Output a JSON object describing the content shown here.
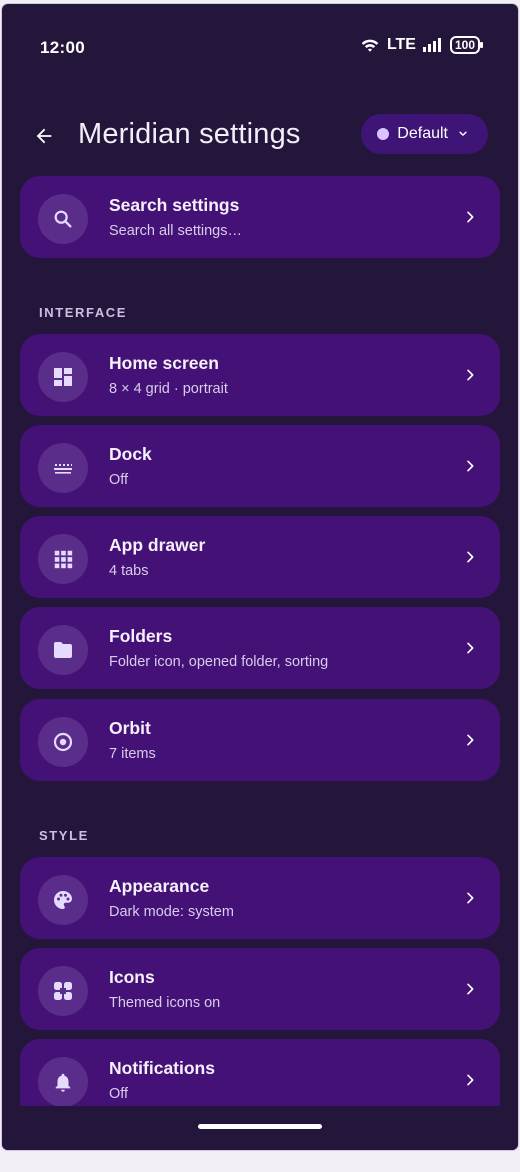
{
  "status_bar": {
    "time": "12:00",
    "network": "LTE",
    "battery": "100"
  },
  "header": {
    "title": "Meridian settings",
    "profile_label": "Default"
  },
  "search_card": {
    "title": "Search settings",
    "subtitle": "Search all settings…",
    "icon": "search-icon"
  },
  "sections": [
    {
      "label": "INTERFACE",
      "items": [
        {
          "title": "Home screen",
          "subtitle": "8 × 4 grid · portrait",
          "icon": "dashboard-icon"
        },
        {
          "title": "Dock",
          "subtitle": "Off",
          "icon": "dock-icon"
        },
        {
          "title": "App drawer",
          "subtitle": "4 tabs",
          "icon": "apps-grid-icon"
        },
        {
          "title": "Folders",
          "subtitle": "Folder icon, opened folder, sorting",
          "icon": "folder-icon"
        },
        {
          "title": "Orbit",
          "subtitle": "7 items",
          "icon": "orbit-icon"
        }
      ]
    },
    {
      "label": "STYLE",
      "items": [
        {
          "title": "Appearance",
          "subtitle": "Dark mode: system",
          "icon": "palette-icon"
        },
        {
          "title": "Icons",
          "subtitle": "Themed icons on",
          "icon": "icon-shapes-icon"
        },
        {
          "title": "Notifications",
          "subtitle": "Off",
          "icon": "bell-icon"
        }
      ]
    }
  ],
  "colors": {
    "background": "#23163a",
    "card": "#441276",
    "icon_circle": "#5b2d8a",
    "accent": "#d9c4ff"
  }
}
